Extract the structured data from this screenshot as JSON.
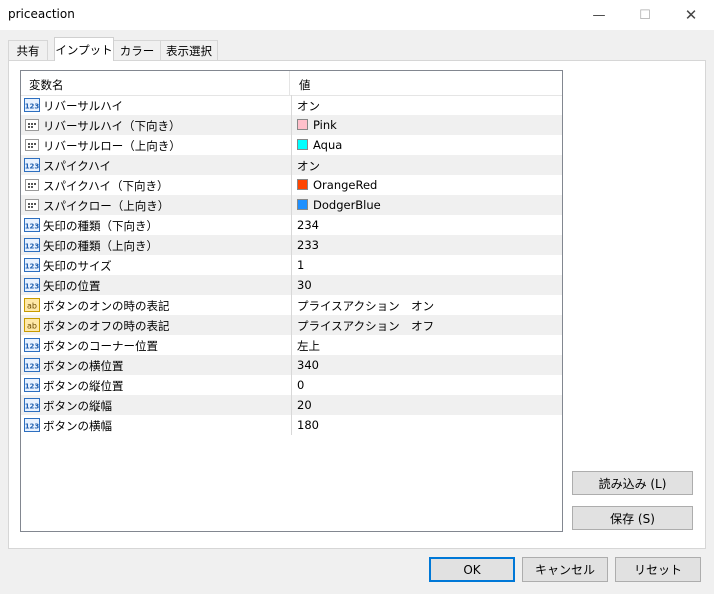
{
  "window": {
    "title": "priceaction"
  },
  "tabs": [
    {
      "label": "共有",
      "active": false
    },
    {
      "label": "インプット",
      "active": true
    },
    {
      "label": "カラー",
      "active": false
    },
    {
      "label": "表示選択",
      "active": false
    }
  ],
  "grid": {
    "col_name": "変数名",
    "col_value": "値",
    "rows": [
      {
        "icon": "int-icon",
        "name": "リバーサルハイ",
        "value": "オン"
      },
      {
        "icon": "color-icon",
        "name": "リバーサルハイ（下向き）",
        "value": "Pink",
        "color": "#ffc0cb"
      },
      {
        "icon": "color-icon",
        "name": "リバーサルロー（上向き）",
        "value": "Aqua",
        "color": "#00ffff"
      },
      {
        "icon": "int-icon",
        "name": "スパイクハイ",
        "value": "オン"
      },
      {
        "icon": "color-icon",
        "name": "スパイクハイ（下向き）",
        "value": "OrangeRed",
        "color": "#ff4500"
      },
      {
        "icon": "color-icon",
        "name": "スパイクロー（上向き）",
        "value": "DodgerBlue",
        "color": "#1e90ff"
      },
      {
        "icon": "int-icon",
        "name": "矢印の種類（下向き）",
        "value": "234"
      },
      {
        "icon": "int-icon",
        "name": "矢印の種類（上向き）",
        "value": "233"
      },
      {
        "icon": "int-icon",
        "name": "矢印のサイズ",
        "value": "1"
      },
      {
        "icon": "int-icon",
        "name": "矢印の位置",
        "value": "30"
      },
      {
        "icon": "string-icon",
        "name": "ボタンのオンの時の表記",
        "value": "プライスアクション　オン"
      },
      {
        "icon": "string-icon",
        "name": "ボタンのオフの時の表記",
        "value": "プライスアクション　オフ"
      },
      {
        "icon": "int-icon",
        "name": "ボタンのコーナー位置",
        "value": "左上"
      },
      {
        "icon": "int-icon",
        "name": "ボタンの横位置",
        "value": "340"
      },
      {
        "icon": "int-icon",
        "name": "ボタンの縦位置",
        "value": "0"
      },
      {
        "icon": "int-icon",
        "name": "ボタンの縦幅",
        "value": "20"
      },
      {
        "icon": "int-icon",
        "name": "ボタンの横幅",
        "value": "180"
      }
    ]
  },
  "side_buttons": {
    "load": "読み込み (L)",
    "save": "保存 (S)"
  },
  "footer": {
    "ok": "OK",
    "cancel": "キャンセル",
    "reset": "リセット"
  }
}
